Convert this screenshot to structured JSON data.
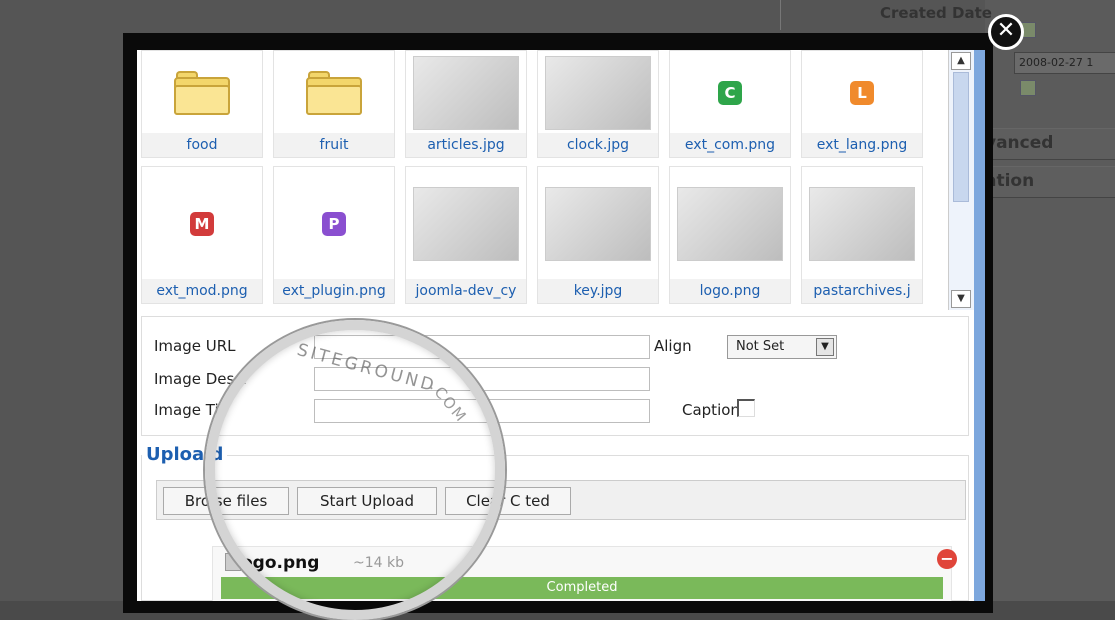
{
  "background": {
    "created_date_label": "Created Date",
    "date_value": "2008-02-27 1",
    "advanced_label": "vanced",
    "publication_label": "ation"
  },
  "images": [
    {
      "name": "food",
      "kind": "folder"
    },
    {
      "name": "fruit",
      "kind": "folder"
    },
    {
      "name": "articles.jpg",
      "kind": "photo"
    },
    {
      "name": "clock.jpg",
      "kind": "photo"
    },
    {
      "name": "ext_com.png",
      "kind": "badge",
      "letter": "C",
      "color": "#2ea54a"
    },
    {
      "name": "ext_lang.png",
      "kind": "badge",
      "letter": "L",
      "color": "#f08a2c"
    },
    {
      "name": "ext_mod.png",
      "kind": "badge",
      "letter": "M",
      "color": "#d23b3b"
    },
    {
      "name": "ext_plugin.png",
      "kind": "badge",
      "letter": "P",
      "color": "#8a4fd0"
    },
    {
      "name": "joomla-dev_cy",
      "kind": "photo"
    },
    {
      "name": "key.jpg",
      "kind": "photo"
    },
    {
      "name": "logo.png",
      "kind": "photo"
    },
    {
      "name": "pastarchives.j",
      "kind": "photo"
    }
  ],
  "form": {
    "image_url_label": "Image URL",
    "image_description_label": "Image Descr",
    "image_title_label": "Image Tit",
    "align_label": "Align",
    "align_value": "Not Set",
    "caption_label": "Caption"
  },
  "upload": {
    "title": "Uploa d",
    "browse_label": "Bro se files",
    "start_label": "Start Upload",
    "clear_label": "Clear C ted",
    "file_name": "ogo.png",
    "file_size": "~14 kb",
    "status": "Completed",
    "progress": 1.0
  },
  "watermark": {
    "line1": "SITEGROUND",
    "line2": ".COM"
  },
  "icons": {
    "close": "close-icon",
    "remove": "remove-icon"
  }
}
